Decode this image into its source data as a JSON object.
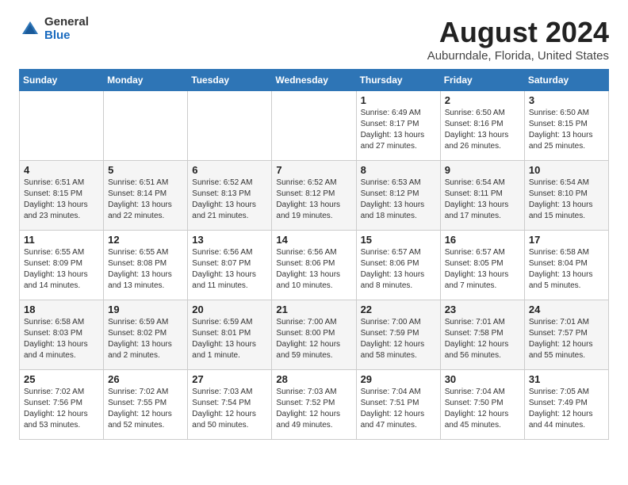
{
  "logo": {
    "general": "General",
    "blue": "Blue"
  },
  "title": "August 2024",
  "subtitle": "Auburndale, Florida, United States",
  "headers": [
    "Sunday",
    "Monday",
    "Tuesday",
    "Wednesday",
    "Thursday",
    "Friday",
    "Saturday"
  ],
  "weeks": [
    [
      {
        "day": "",
        "info": ""
      },
      {
        "day": "",
        "info": ""
      },
      {
        "day": "",
        "info": ""
      },
      {
        "day": "",
        "info": ""
      },
      {
        "day": "1",
        "info": "Sunrise: 6:49 AM\nSunset: 8:17 PM\nDaylight: 13 hours\nand 27 minutes."
      },
      {
        "day": "2",
        "info": "Sunrise: 6:50 AM\nSunset: 8:16 PM\nDaylight: 13 hours\nand 26 minutes."
      },
      {
        "day": "3",
        "info": "Sunrise: 6:50 AM\nSunset: 8:15 PM\nDaylight: 13 hours\nand 25 minutes."
      }
    ],
    [
      {
        "day": "4",
        "info": "Sunrise: 6:51 AM\nSunset: 8:15 PM\nDaylight: 13 hours\nand 23 minutes."
      },
      {
        "day": "5",
        "info": "Sunrise: 6:51 AM\nSunset: 8:14 PM\nDaylight: 13 hours\nand 22 minutes."
      },
      {
        "day": "6",
        "info": "Sunrise: 6:52 AM\nSunset: 8:13 PM\nDaylight: 13 hours\nand 21 minutes."
      },
      {
        "day": "7",
        "info": "Sunrise: 6:52 AM\nSunset: 8:12 PM\nDaylight: 13 hours\nand 19 minutes."
      },
      {
        "day": "8",
        "info": "Sunrise: 6:53 AM\nSunset: 8:12 PM\nDaylight: 13 hours\nand 18 minutes."
      },
      {
        "day": "9",
        "info": "Sunrise: 6:54 AM\nSunset: 8:11 PM\nDaylight: 13 hours\nand 17 minutes."
      },
      {
        "day": "10",
        "info": "Sunrise: 6:54 AM\nSunset: 8:10 PM\nDaylight: 13 hours\nand 15 minutes."
      }
    ],
    [
      {
        "day": "11",
        "info": "Sunrise: 6:55 AM\nSunset: 8:09 PM\nDaylight: 13 hours\nand 14 minutes."
      },
      {
        "day": "12",
        "info": "Sunrise: 6:55 AM\nSunset: 8:08 PM\nDaylight: 13 hours\nand 13 minutes."
      },
      {
        "day": "13",
        "info": "Sunrise: 6:56 AM\nSunset: 8:07 PM\nDaylight: 13 hours\nand 11 minutes."
      },
      {
        "day": "14",
        "info": "Sunrise: 6:56 AM\nSunset: 8:06 PM\nDaylight: 13 hours\nand 10 minutes."
      },
      {
        "day": "15",
        "info": "Sunrise: 6:57 AM\nSunset: 8:06 PM\nDaylight: 13 hours\nand 8 minutes."
      },
      {
        "day": "16",
        "info": "Sunrise: 6:57 AM\nSunset: 8:05 PM\nDaylight: 13 hours\nand 7 minutes."
      },
      {
        "day": "17",
        "info": "Sunrise: 6:58 AM\nSunset: 8:04 PM\nDaylight: 13 hours\nand 5 minutes."
      }
    ],
    [
      {
        "day": "18",
        "info": "Sunrise: 6:58 AM\nSunset: 8:03 PM\nDaylight: 13 hours\nand 4 minutes."
      },
      {
        "day": "19",
        "info": "Sunrise: 6:59 AM\nSunset: 8:02 PM\nDaylight: 13 hours\nand 2 minutes."
      },
      {
        "day": "20",
        "info": "Sunrise: 6:59 AM\nSunset: 8:01 PM\nDaylight: 13 hours\nand 1 minute."
      },
      {
        "day": "21",
        "info": "Sunrise: 7:00 AM\nSunset: 8:00 PM\nDaylight: 12 hours\nand 59 minutes."
      },
      {
        "day": "22",
        "info": "Sunrise: 7:00 AM\nSunset: 7:59 PM\nDaylight: 12 hours\nand 58 minutes."
      },
      {
        "day": "23",
        "info": "Sunrise: 7:01 AM\nSunset: 7:58 PM\nDaylight: 12 hours\nand 56 minutes."
      },
      {
        "day": "24",
        "info": "Sunrise: 7:01 AM\nSunset: 7:57 PM\nDaylight: 12 hours\nand 55 minutes."
      }
    ],
    [
      {
        "day": "25",
        "info": "Sunrise: 7:02 AM\nSunset: 7:56 PM\nDaylight: 12 hours\nand 53 minutes."
      },
      {
        "day": "26",
        "info": "Sunrise: 7:02 AM\nSunset: 7:55 PM\nDaylight: 12 hours\nand 52 minutes."
      },
      {
        "day": "27",
        "info": "Sunrise: 7:03 AM\nSunset: 7:54 PM\nDaylight: 12 hours\nand 50 minutes."
      },
      {
        "day": "28",
        "info": "Sunrise: 7:03 AM\nSunset: 7:52 PM\nDaylight: 12 hours\nand 49 minutes."
      },
      {
        "day": "29",
        "info": "Sunrise: 7:04 AM\nSunset: 7:51 PM\nDaylight: 12 hours\nand 47 minutes."
      },
      {
        "day": "30",
        "info": "Sunrise: 7:04 AM\nSunset: 7:50 PM\nDaylight: 12 hours\nand 45 minutes."
      },
      {
        "day": "31",
        "info": "Sunrise: 7:05 AM\nSunset: 7:49 PM\nDaylight: 12 hours\nand 44 minutes."
      }
    ]
  ]
}
